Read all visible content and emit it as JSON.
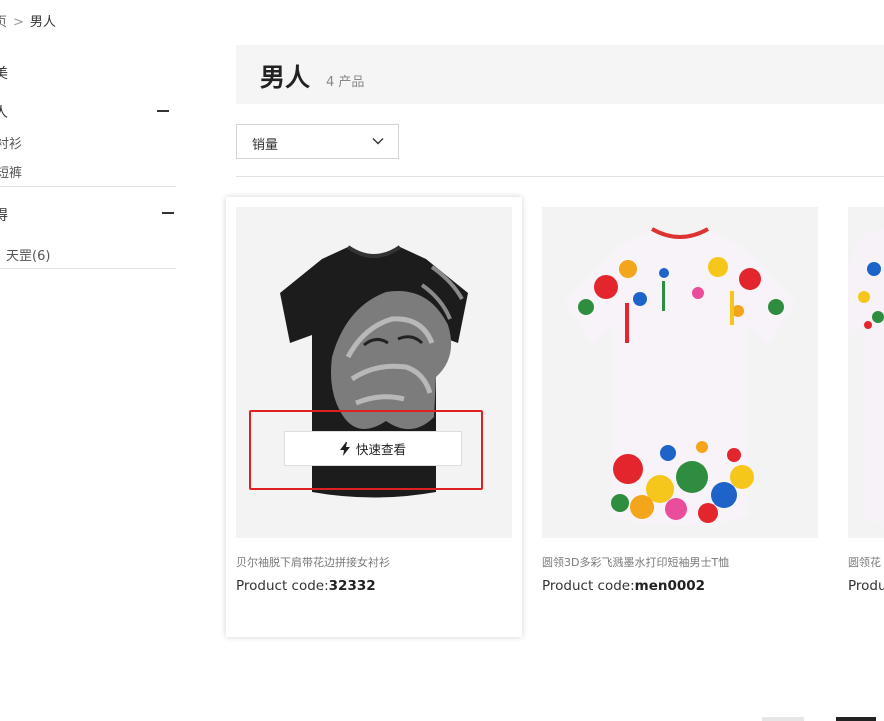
{
  "breadcrumb": {
    "home": "页",
    "separator": ">",
    "current": "男人"
  },
  "sidebar": {
    "group1_title": "美",
    "category_label": "人",
    "category_items": [
      "衬衫",
      "短裤"
    ],
    "group2_title": "得",
    "filter_items": [
      "天罡(6)"
    ]
  },
  "header": {
    "title": "男人",
    "count": "4 产品"
  },
  "sort": {
    "selected": "销量"
  },
  "products": [
    {
      "name": "贝尔袖脱下肩带花边拼接女衬衫",
      "code_label": "Product code:",
      "code": "32332"
    },
    {
      "name": "圆领3D多彩飞溅墨水打印短袖男士T恤",
      "code_label": "Product code:",
      "code": "men0002"
    },
    {
      "name": "圆领花",
      "code_label": "Produ",
      "code": ""
    }
  ],
  "quick_view": {
    "label": "快速查看"
  },
  "colors": {
    "accent_highlight": "#e02020",
    "header_bg": "#f5f5f5"
  },
  "icons": {
    "quick_view": "lightning-bolt-icon",
    "sort": "chevron-down-icon",
    "collapse": "minus-icon"
  }
}
